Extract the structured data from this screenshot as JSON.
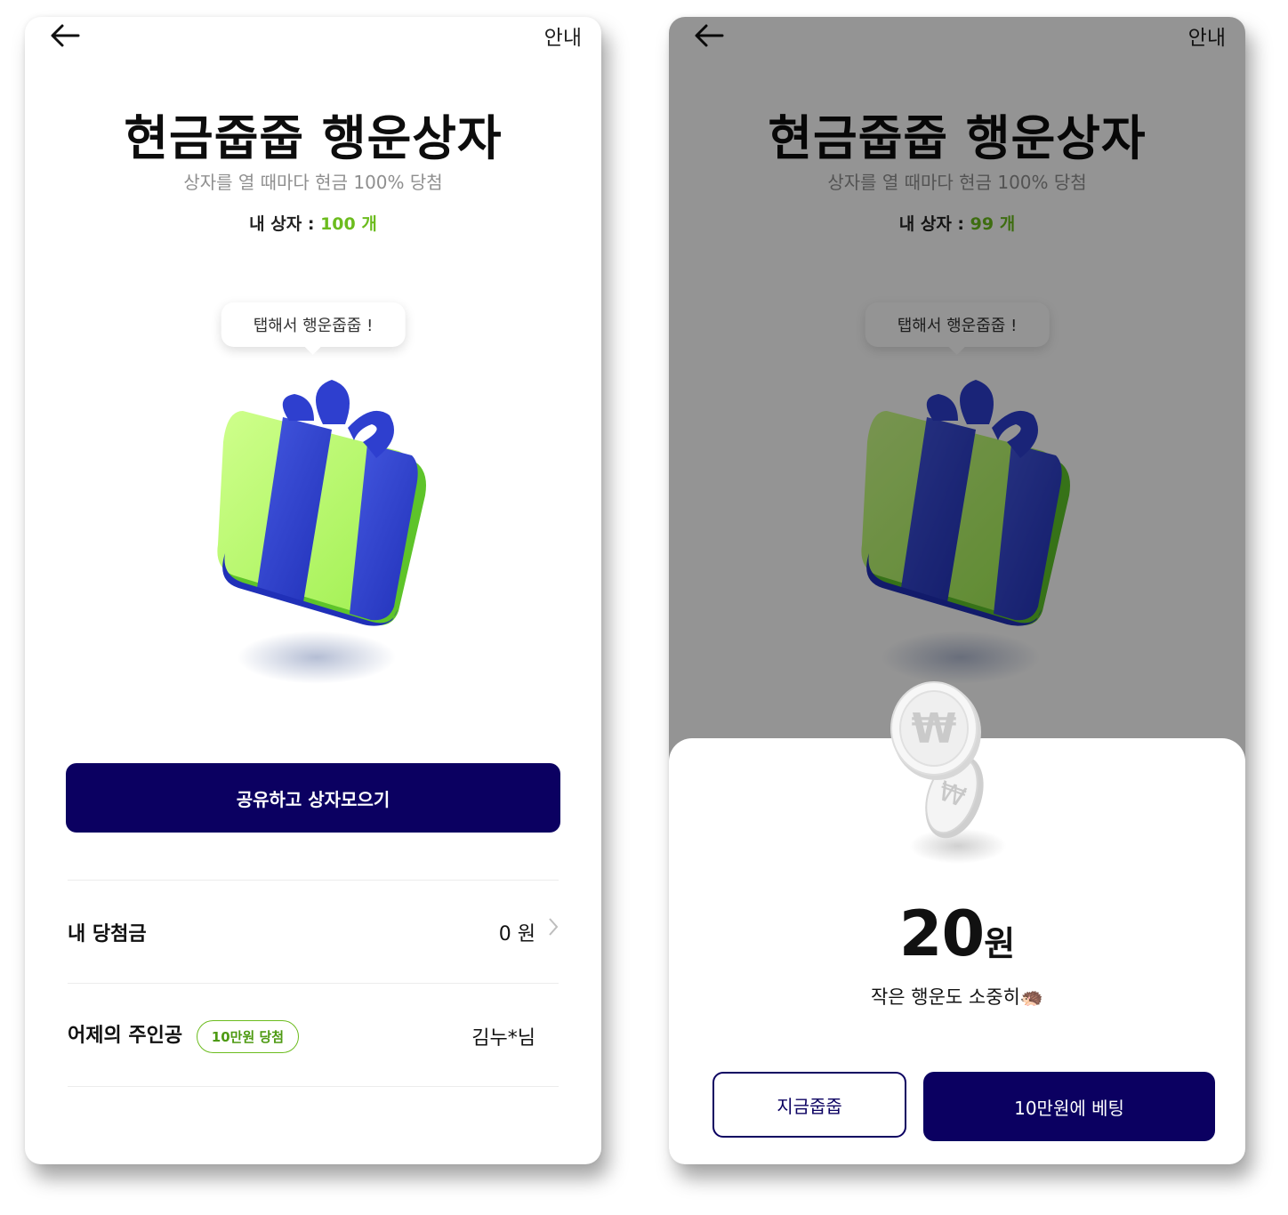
{
  "left_screen": {
    "guide_label": "안내",
    "title": "현금줍줍 행운상자",
    "subtitle": "상자를 열 때마다 현금 100% 당첨",
    "box_count_label": "내 상자 :",
    "box_count_value": "100 개",
    "bubble_text": "탭해서 행운줍줍 !",
    "share_button": "공유하고 상자모으기",
    "winnings_label": "내 당첨금",
    "winnings_value": "0 원",
    "yesterday_label": "어제의 주인공",
    "yesterday_badge": "10만원 당첨",
    "yesterday_winner": "김누*님"
  },
  "right_screen": {
    "guide_label": "안내",
    "title": "현금줍줍 행운상자",
    "subtitle": "상자를 열 때마다 현금 100% 당첨",
    "box_count_label": "내 상자 :",
    "box_count_value": "99 개",
    "bubble_text": "탭해서 행운줍줍 !",
    "result_amount": "20",
    "result_unit": "원",
    "result_message": "작은 행운도 소중히🦔",
    "collect_button": "지금줍줍",
    "bet_button": "10만원에 베팅"
  },
  "colors": {
    "primary": "#0b0061",
    "accent_green": "#6cbc1e",
    "gift_green": "#b8ff6a",
    "gift_blue": "#2e3fcf"
  },
  "icons": [
    "back-arrow-icon",
    "gift-box-icon",
    "chevron-right-icon",
    "won-coin-icon",
    "hedgehog-emoji"
  ]
}
